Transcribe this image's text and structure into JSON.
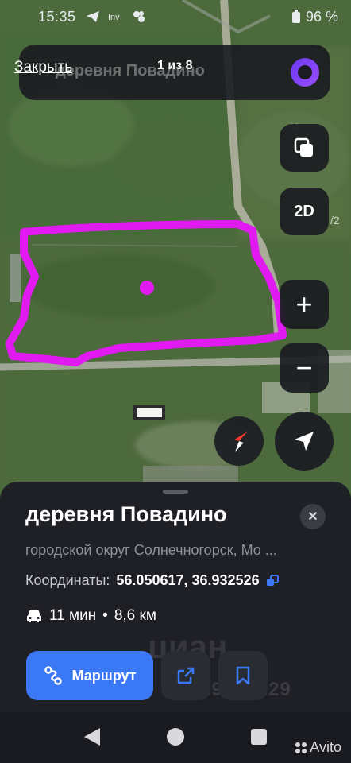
{
  "status_bar": {
    "time": "15:35",
    "battery": "96 %"
  },
  "top_bar": {
    "close_label": "Закрыть",
    "counter": "1 из 8",
    "search_text": "деревня Повадино"
  },
  "map": {
    "scale_fragment": "68",
    "side_fragment": "/2",
    "mode_label": "2D",
    "zoom_in_label": "+",
    "zoom_out_label": "−",
    "highlight_color": "#e01af0"
  },
  "place_card": {
    "title": "деревня Повадино",
    "subtitle": "городской округ Солнечногорск, Мо ...",
    "coords_label": "Координаты:",
    "coords_value": "56.050617, 36.932526",
    "travel_time": "11 мин",
    "separator": "•",
    "distance": "8,6 км",
    "route_button": "Маршрут",
    "accent_color": "#3b78f5"
  },
  "watermark": {
    "brand": "циан",
    "id_text": "ID 329456229"
  },
  "nav_bar": {
    "avito_label": "Avito"
  }
}
